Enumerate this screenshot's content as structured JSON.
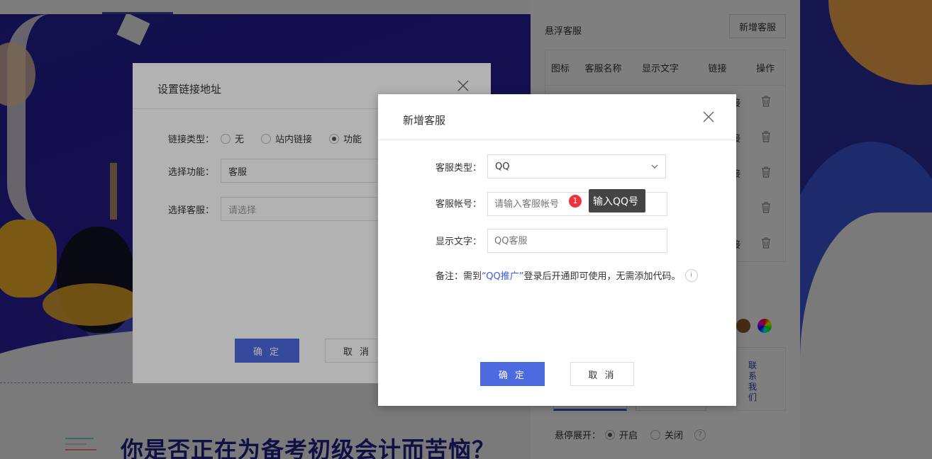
{
  "background": {
    "headline": "你是否正在为备考初级会计而苦恼？",
    "right_panel": {
      "title": "悬浮客服",
      "add_button": "新增客服",
      "columns": [
        "图标",
        "客服名称",
        "显示文字",
        "链接",
        "操作"
      ],
      "row_link_fragment": "接",
      "preview_text": "联系我们",
      "hover_expand_label": "悬停展开：",
      "hover_on": "开启",
      "hover_off": "关闭",
      "help": "?",
      "colors": [
        "#8b5a2b",
        "#e0a040"
      ]
    }
  },
  "dialog_link": {
    "title": "设置链接地址",
    "link_type_label": "链接类型：",
    "options": [
      "无",
      "站内链接",
      "功能"
    ],
    "selected_option": "功能",
    "function_label": "选择功能：",
    "function_value": "客服",
    "service_label": "选择客服：",
    "service_placeholder": "请选择",
    "ok": "确 定",
    "cancel": "取 消"
  },
  "dialog_add_service": {
    "title": "新增客服",
    "type_label": "客服类型：",
    "type_value": "QQ",
    "account_label": "客服帐号：",
    "account_placeholder": "请输入客服帐号",
    "display_label": "显示文字：",
    "display_placeholder": "QQ客服",
    "note_prefix": "备注：需到",
    "note_link": "“QQ推广”",
    "note_suffix": "登录后开通即可使用，无需添加代码。",
    "info": "i",
    "ok": "确 定",
    "cancel": "取 消"
  },
  "tooltip": {
    "badge": "1",
    "text": "输入QQ号"
  }
}
